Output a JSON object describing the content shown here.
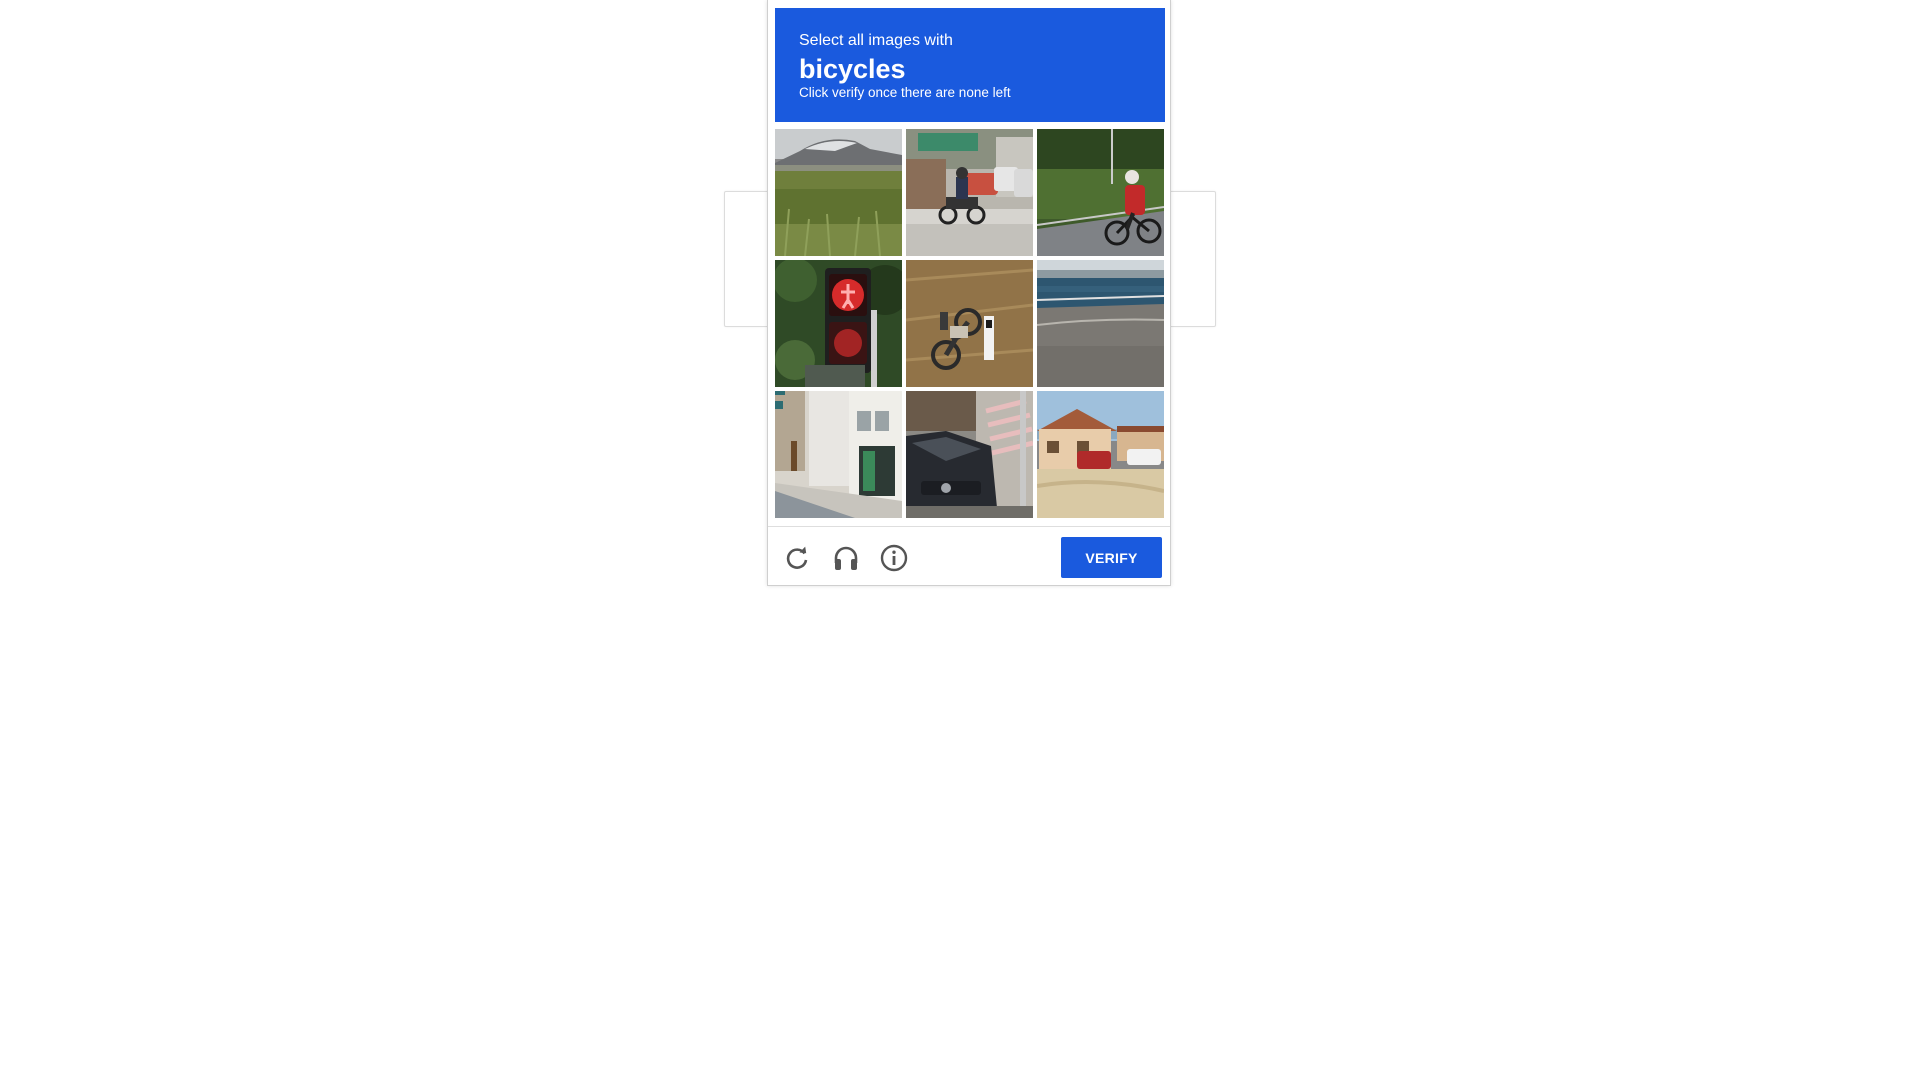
{
  "challenge": {
    "instruction": "Select all images with",
    "keyword": "bicycles",
    "sub_instruction": "Click verify once there are none left",
    "verify_label": "VERIFY",
    "accent_color": "#1a5ade"
  },
  "tiles": [
    {
      "row": 1,
      "col": 1,
      "scene": "grass field with stadium roof"
    },
    {
      "row": 1,
      "col": 2,
      "scene": "motorcyclist on street with cars"
    },
    {
      "row": 1,
      "col": 3,
      "scene": "cyclist in red riding bicycle"
    },
    {
      "row": 2,
      "col": 1,
      "scene": "red pedestrian traffic light"
    },
    {
      "row": 2,
      "col": 2,
      "scene": "motorcycle parked on dirt"
    },
    {
      "row": 2,
      "col": 3,
      "scene": "road by water with railing"
    },
    {
      "row": 3,
      "col": 1,
      "scene": "sidewalk with shops"
    },
    {
      "row": 3,
      "col": 2,
      "scene": "dark car at crosswalk"
    },
    {
      "row": 3,
      "col": 3,
      "scene": "houses with parked cars"
    }
  ],
  "footer": {
    "icons": [
      "reload-icon",
      "headphones-icon",
      "info-icon"
    ]
  }
}
